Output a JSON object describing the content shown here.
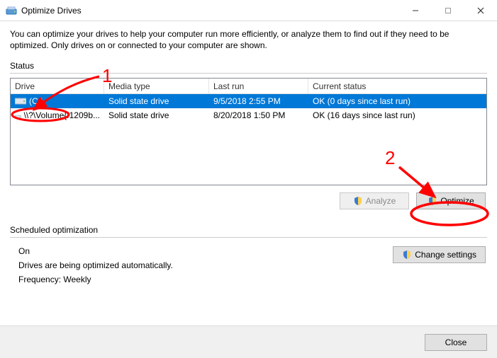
{
  "window": {
    "title": "Optimize Drives"
  },
  "intro": "You can optimize your drives to help your computer run more efficiently, or analyze them to find out if they need to be optimized. Only drives on or connected to your computer are shown.",
  "status_label": "Status",
  "table": {
    "headers": {
      "drive": "Drive",
      "media_type": "Media type",
      "last_run": "Last run",
      "current_status": "Current status"
    },
    "rows": [
      {
        "drive": "(C:)",
        "media_type": "Solid state drive",
        "last_run": "9/5/2018 2:55 PM",
        "current_status": "OK (0 days since last run)",
        "selected": true
      },
      {
        "drive": "\\\\?\\Volume{f1209b...",
        "media_type": "Solid state drive",
        "last_run": "8/20/2018 1:50 PM",
        "current_status": "OK (16 days since last run)",
        "selected": false
      }
    ]
  },
  "buttons": {
    "analyze": "Analyze",
    "optimize": "Optimize",
    "change_settings": "Change settings",
    "close": "Close"
  },
  "scheduled": {
    "label": "Scheduled optimization",
    "state": "On",
    "desc": "Drives are being optimized automatically.",
    "frequency": "Frequency: Weekly"
  },
  "annotations": {
    "one": "1",
    "two": "2"
  }
}
